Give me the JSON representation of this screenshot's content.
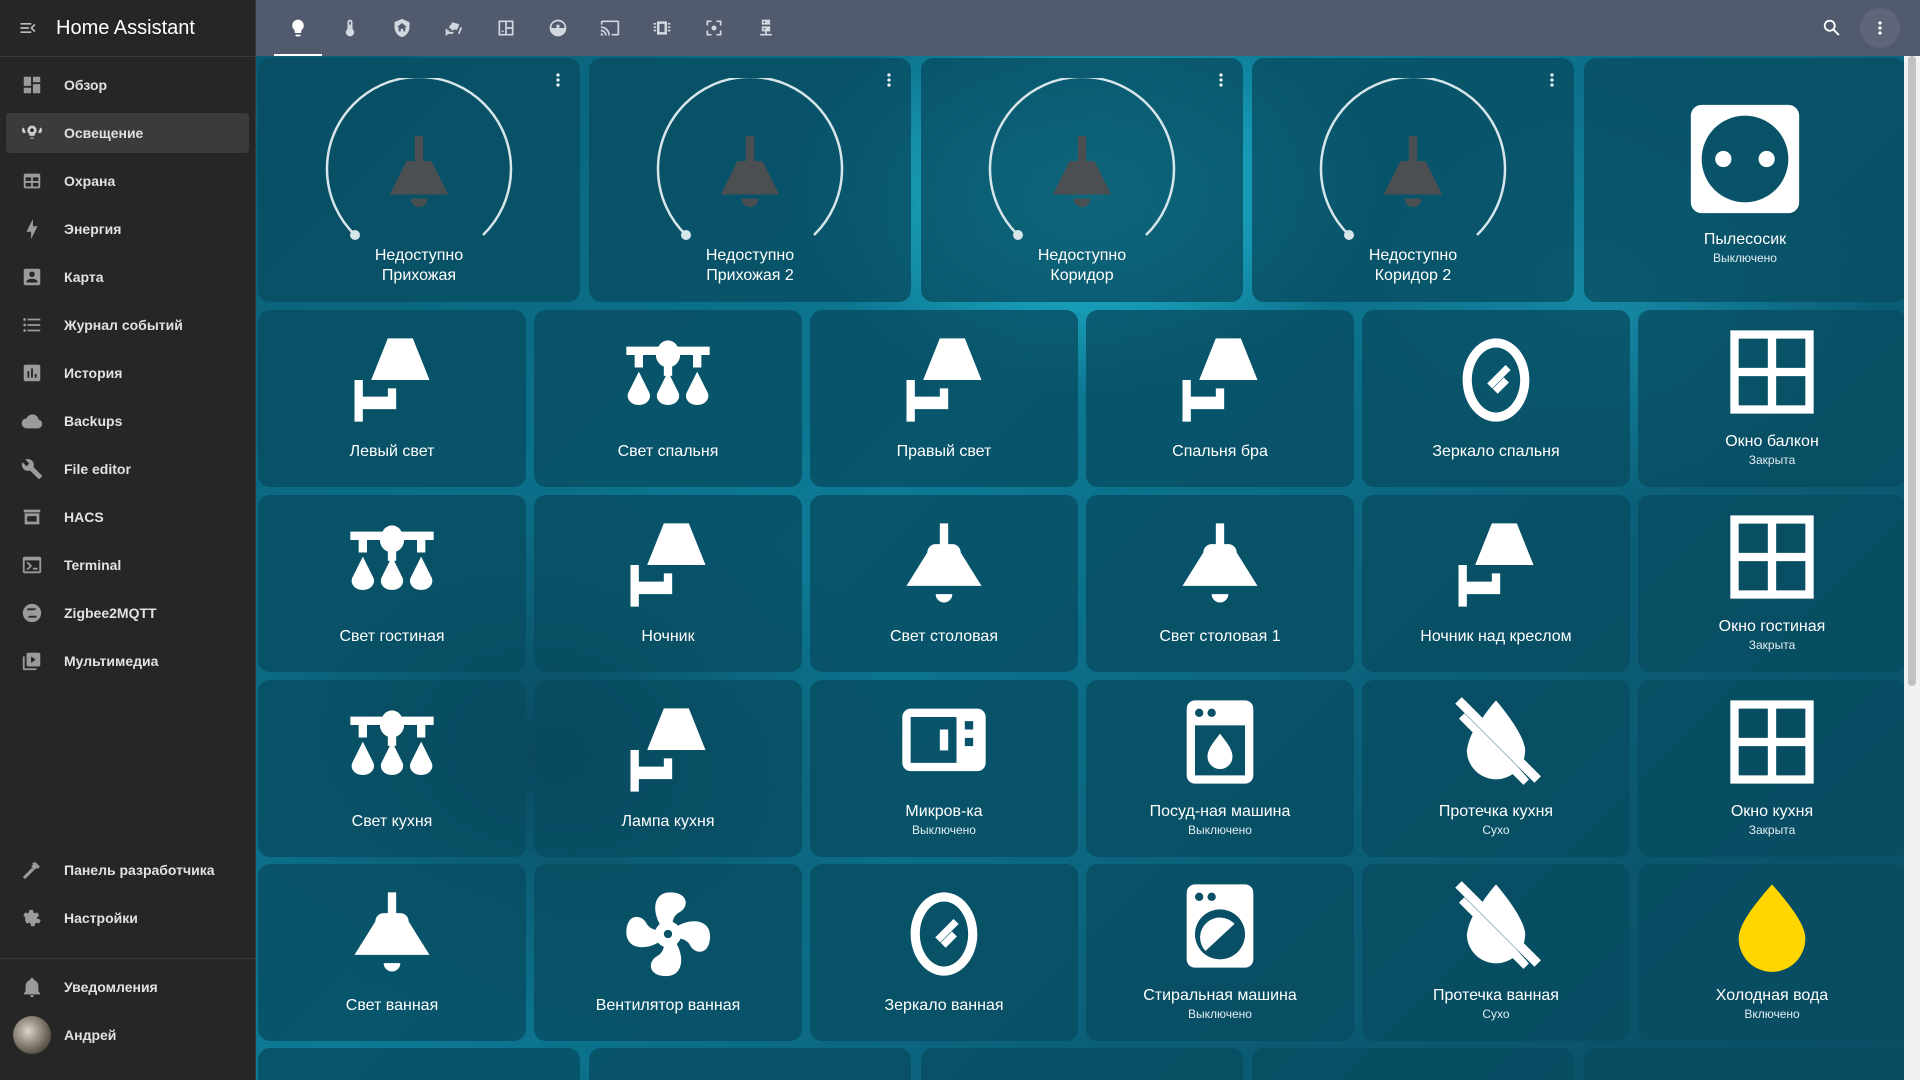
{
  "app": {
    "title": "Home Assistant"
  },
  "sidebar": {
    "items": [
      {
        "label": "Обзор",
        "icon": "view-dashboard-icon"
      },
      {
        "label": "Освещение",
        "icon": "lightbulb-group-icon",
        "active": true
      },
      {
        "label": "Охрана",
        "icon": "table-icon"
      },
      {
        "label": "Энергия",
        "icon": "lightning-bolt-icon"
      },
      {
        "label": "Карта",
        "icon": "account-box-icon"
      },
      {
        "label": "Журнал событий",
        "icon": "format-list-bulleted-icon"
      },
      {
        "label": "История",
        "icon": "chart-box-icon"
      },
      {
        "label": "Backups",
        "icon": "cloud-icon"
      },
      {
        "label": "File editor",
        "icon": "wrench-icon"
      },
      {
        "label": "HACS",
        "icon": "hacs-icon"
      },
      {
        "label": "Terminal",
        "icon": "console-icon"
      },
      {
        "label": "Zigbee2MQTT",
        "icon": "zigbee-icon"
      },
      {
        "label": "Мультимедиа",
        "icon": "play-box-icon"
      }
    ],
    "bottom": [
      {
        "label": "Панель разработчика",
        "icon": "hammer-icon"
      },
      {
        "label": "Настройки",
        "icon": "cog-icon"
      }
    ],
    "notifications": {
      "label": "Уведомления",
      "icon": "bell-icon"
    },
    "user": {
      "label": "Андрей"
    }
  },
  "header": {
    "tabs": [
      "lightbulb-icon",
      "thermometer-icon",
      "shield-home-icon",
      "cctv-icon",
      "door-window-icon",
      "robot-vacuum-icon",
      "cast-icon",
      "chip-icon",
      "focus-icon",
      "server-network-icon"
    ],
    "selected_tab": 0
  },
  "dashboard": {
    "row1": [
      {
        "name": "Недоступно",
        "name2": "Прихожая"
      },
      {
        "name": "Недоступно",
        "name2": "Прихожая 2"
      },
      {
        "name": "Недоступно",
        "name2": "Коридор"
      },
      {
        "name": "Недоступно",
        "name2": "Коридор 2"
      },
      {
        "name": "Пылесосик",
        "state": "Выключено",
        "icon": "power-socket-icon"
      }
    ],
    "grid": [
      {
        "name": "Левый свет",
        "icon": "wall-lamp-icon"
      },
      {
        "name": "Свет спальня",
        "icon": "chandelier-icon"
      },
      {
        "name": "Правый свет",
        "icon": "wall-lamp-icon"
      },
      {
        "name": "Спальня бра",
        "icon": "wall-lamp-icon"
      },
      {
        "name": "Зеркало спальня",
        "icon": "mirror-icon"
      },
      {
        "name": "Окно балкон",
        "state": "Закрыта",
        "icon": "window-icon"
      },
      {
        "name": "Свет гостиная",
        "icon": "chandelier-icon"
      },
      {
        "name": "Ночник",
        "icon": "wall-lamp-icon"
      },
      {
        "name": "Свет столовая",
        "icon": "ceiling-light-icon"
      },
      {
        "name": "Свет столовая 1",
        "icon": "ceiling-light-icon"
      },
      {
        "name": "Ночник над креслом",
        "icon": "wall-lamp-icon"
      },
      {
        "name": "Окно гостиная",
        "state": "Закрыта",
        "icon": "window-icon"
      },
      {
        "name": "Свет кухня",
        "icon": "chandelier-icon"
      },
      {
        "name": "Лампа кухня",
        "icon": "wall-lamp-icon"
      },
      {
        "name": "Микров-ка",
        "state": "Выключено",
        "icon": "microwave-icon"
      },
      {
        "name": "Посуд-ная машина",
        "state": "Выключено",
        "icon": "dishwasher-icon"
      },
      {
        "name": "Протечка кухня",
        "state": "Сухо",
        "icon": "water-off-icon"
      },
      {
        "name": "Окно кухня",
        "state": "Закрыта",
        "icon": "window-icon"
      },
      {
        "name": "Свет ванная",
        "icon": "ceiling-light-icon"
      },
      {
        "name": "Вентилятор ванная",
        "icon": "fan-icon"
      },
      {
        "name": "Зеркало ванная",
        "icon": "mirror-icon"
      },
      {
        "name": "Стиральная машина",
        "state": "Выключено",
        "icon": "washing-machine-icon"
      },
      {
        "name": "Протечка ванная",
        "state": "Сухо",
        "icon": "water-off-icon"
      },
      {
        "name": "Холодная вода",
        "state": "Включено",
        "icon": "water-drop-icon"
      }
    ]
  },
  "colors": {
    "accent": "#ffd600",
    "sidebar": "#262626",
    "header": "#525a6e"
  }
}
